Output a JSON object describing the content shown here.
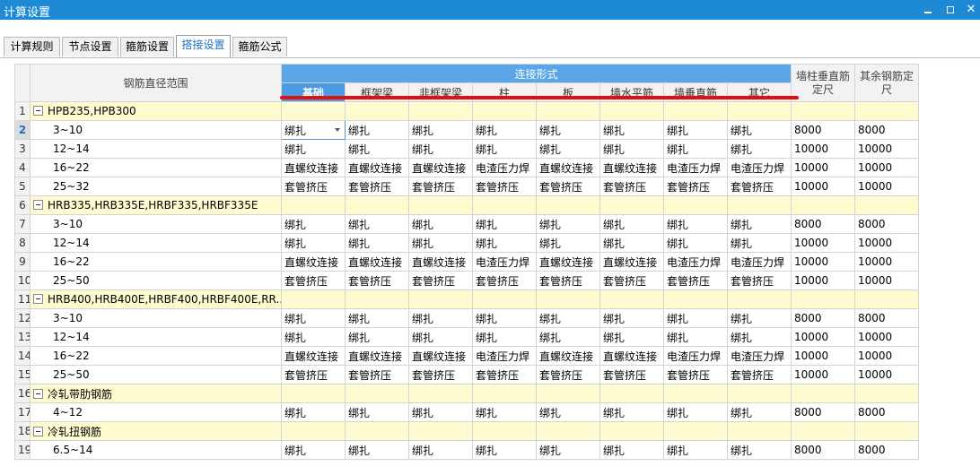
{
  "window": {
    "title": "计算设置"
  },
  "tabs": [
    {
      "label": "计算规则",
      "active": false
    },
    {
      "label": "节点设置",
      "active": false
    },
    {
      "label": "箍筋设置",
      "active": false
    },
    {
      "label": "搭接设置",
      "active": true
    },
    {
      "label": "箍筋公式",
      "active": false
    }
  ],
  "grid": {
    "col_range_header": "钢筋直径范围",
    "group_header": "连接形式",
    "sub_headers": [
      "基础",
      "框架梁",
      "非框架梁",
      "柱",
      "板",
      "墙水平筋",
      "墙垂直筋",
      "其它"
    ],
    "col_wall_vertical_length": "墙柱垂直筋定尺",
    "col_other_length": "其余钢筋定尺",
    "rows": [
      {
        "num": "1",
        "group": true,
        "label": "HPB235,HPB300"
      },
      {
        "num": "2",
        "label": "3~10",
        "cells": [
          "绑扎",
          "绑扎",
          "绑扎",
          "绑扎",
          "绑扎",
          "绑扎",
          "绑扎",
          "绑扎"
        ],
        "l1": "8000",
        "l2": "8000",
        "selected": true
      },
      {
        "num": "3",
        "label": "12~14",
        "cells": [
          "绑扎",
          "绑扎",
          "绑扎",
          "绑扎",
          "绑扎",
          "绑扎",
          "绑扎",
          "绑扎"
        ],
        "l1": "10000",
        "l2": "10000"
      },
      {
        "num": "4",
        "label": "16~22",
        "cells": [
          "直螺纹连接",
          "直螺纹连接",
          "直螺纹连接",
          "电渣压力焊",
          "直螺纹连接",
          "直螺纹连接",
          "电渣压力焊",
          "电渣压力焊"
        ],
        "l1": "10000",
        "l2": "10000"
      },
      {
        "num": "5",
        "label": "25~32",
        "cells": [
          "套管挤压",
          "套管挤压",
          "套管挤压",
          "套管挤压",
          "套管挤压",
          "套管挤压",
          "套管挤压",
          "套管挤压"
        ],
        "l1": "10000",
        "l2": "10000"
      },
      {
        "num": "6",
        "group": true,
        "label": "HRB335,HRB335E,HRBF335,HRBF335E"
      },
      {
        "num": "7",
        "label": "3~10",
        "cells": [
          "绑扎",
          "绑扎",
          "绑扎",
          "绑扎",
          "绑扎",
          "绑扎",
          "绑扎",
          "绑扎"
        ],
        "l1": "8000",
        "l2": "8000"
      },
      {
        "num": "8",
        "label": "12~14",
        "cells": [
          "绑扎",
          "绑扎",
          "绑扎",
          "绑扎",
          "绑扎",
          "绑扎",
          "绑扎",
          "绑扎"
        ],
        "l1": "10000",
        "l2": "10000"
      },
      {
        "num": "9",
        "label": "16~22",
        "cells": [
          "直螺纹连接",
          "直螺纹连接",
          "直螺纹连接",
          "电渣压力焊",
          "直螺纹连接",
          "直螺纹连接",
          "电渣压力焊",
          "电渣压力焊"
        ],
        "l1": "10000",
        "l2": "10000"
      },
      {
        "num": "10",
        "label": "25~50",
        "cells": [
          "套管挤压",
          "套管挤压",
          "套管挤压",
          "套管挤压",
          "套管挤压",
          "套管挤压",
          "套管挤压",
          "套管挤压"
        ],
        "l1": "10000",
        "l2": "10000"
      },
      {
        "num": "11",
        "group": true,
        "label": "HRB400,HRB400E,HRBF400,HRBF400E,RR..."
      },
      {
        "num": "12",
        "label": "3~10",
        "cells": [
          "绑扎",
          "绑扎",
          "绑扎",
          "绑扎",
          "绑扎",
          "绑扎",
          "绑扎",
          "绑扎"
        ],
        "l1": "8000",
        "l2": "8000"
      },
      {
        "num": "13",
        "label": "12~14",
        "cells": [
          "绑扎",
          "绑扎",
          "绑扎",
          "绑扎",
          "绑扎",
          "绑扎",
          "绑扎",
          "绑扎"
        ],
        "l1": "10000",
        "l2": "10000"
      },
      {
        "num": "14",
        "label": "16~22",
        "cells": [
          "直螺纹连接",
          "直螺纹连接",
          "直螺纹连接",
          "电渣压力焊",
          "直螺纹连接",
          "直螺纹连接",
          "电渣压力焊",
          "电渣压力焊"
        ],
        "l1": "10000",
        "l2": "10000"
      },
      {
        "num": "15",
        "label": "25~50",
        "cells": [
          "套管挤压",
          "套管挤压",
          "套管挤压",
          "套管挤压",
          "套管挤压",
          "套管挤压",
          "套管挤压",
          "套管挤压"
        ],
        "l1": "10000",
        "l2": "10000"
      },
      {
        "num": "16",
        "group": true,
        "label": "冷轧带肋钢筋"
      },
      {
        "num": "17",
        "label": "4~12",
        "cells": [
          "绑扎",
          "绑扎",
          "绑扎",
          "绑扎",
          "绑扎",
          "绑扎",
          "绑扎",
          "绑扎"
        ],
        "l1": "8000",
        "l2": "8000"
      },
      {
        "num": "18",
        "group": true,
        "label": "冷轧扭钢筋"
      },
      {
        "num": "19",
        "label": "6.5~14",
        "cells": [
          "绑扎",
          "绑扎",
          "绑扎",
          "绑扎",
          "绑扎",
          "绑扎",
          "绑扎",
          "绑扎"
        ],
        "l1": "8000",
        "l2": "8000"
      }
    ]
  },
  "colors": {
    "titlebar": "#1e8ad6",
    "header_blue": "#5aa6e6",
    "group_row": "#fffbd1",
    "annotation": "#e01010"
  }
}
